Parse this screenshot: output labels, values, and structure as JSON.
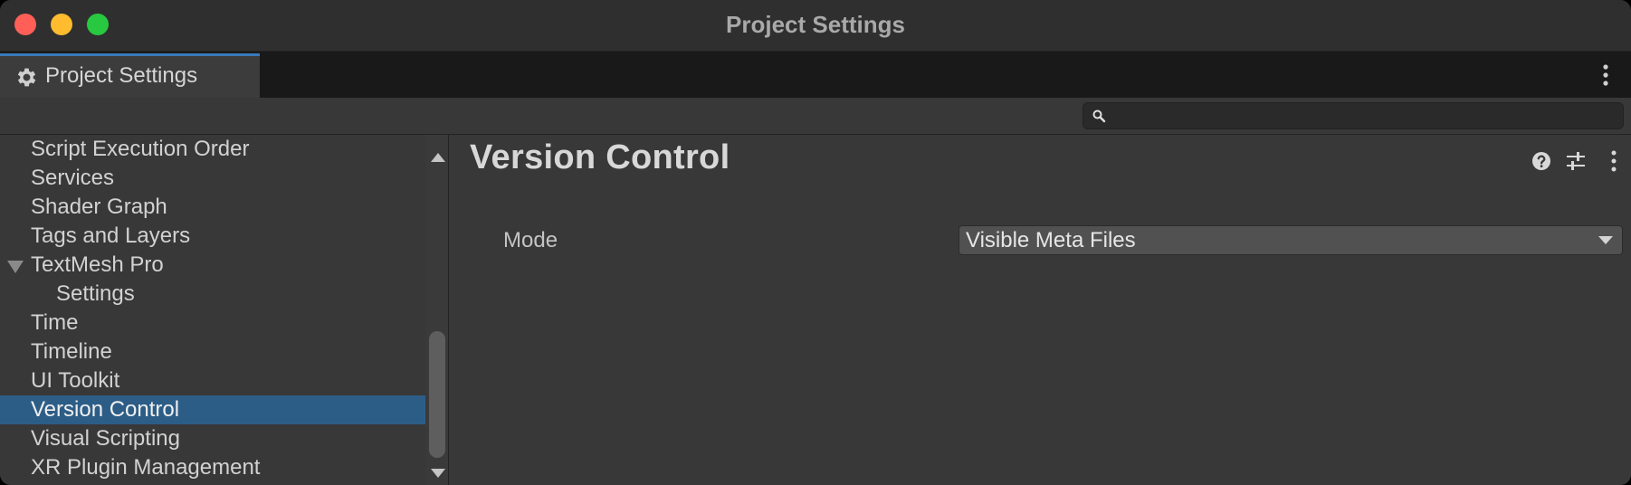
{
  "window": {
    "title": "Project Settings"
  },
  "tab": {
    "label": "Project Settings",
    "icon": "gear-icon"
  },
  "search": {
    "value": "",
    "placeholder": ""
  },
  "sidebar": {
    "items": [
      {
        "label": "Script Execution Order",
        "selected": false
      },
      {
        "label": "Services",
        "selected": false
      },
      {
        "label": "Shader Graph",
        "selected": false
      },
      {
        "label": "Tags and Layers",
        "selected": false
      },
      {
        "label": "TextMesh Pro",
        "selected": false,
        "expanded": true
      },
      {
        "label": "Settings",
        "selected": false,
        "child": true
      },
      {
        "label": "Time",
        "selected": false
      },
      {
        "label": "Timeline",
        "selected": false
      },
      {
        "label": "UI Toolkit",
        "selected": false
      },
      {
        "label": "Version Control",
        "selected": true
      },
      {
        "label": "Visual Scripting",
        "selected": false
      },
      {
        "label": "XR Plugin Management",
        "selected": false
      }
    ]
  },
  "main": {
    "title": "Version Control",
    "mode_label": "Mode",
    "mode_value": "Visible Meta Files"
  },
  "colors": {
    "selection": "#2c5d87",
    "tab_accent": "#3a79bb",
    "close": "#ff5f57",
    "minimize": "#febc2e",
    "maximize": "#28c840"
  }
}
